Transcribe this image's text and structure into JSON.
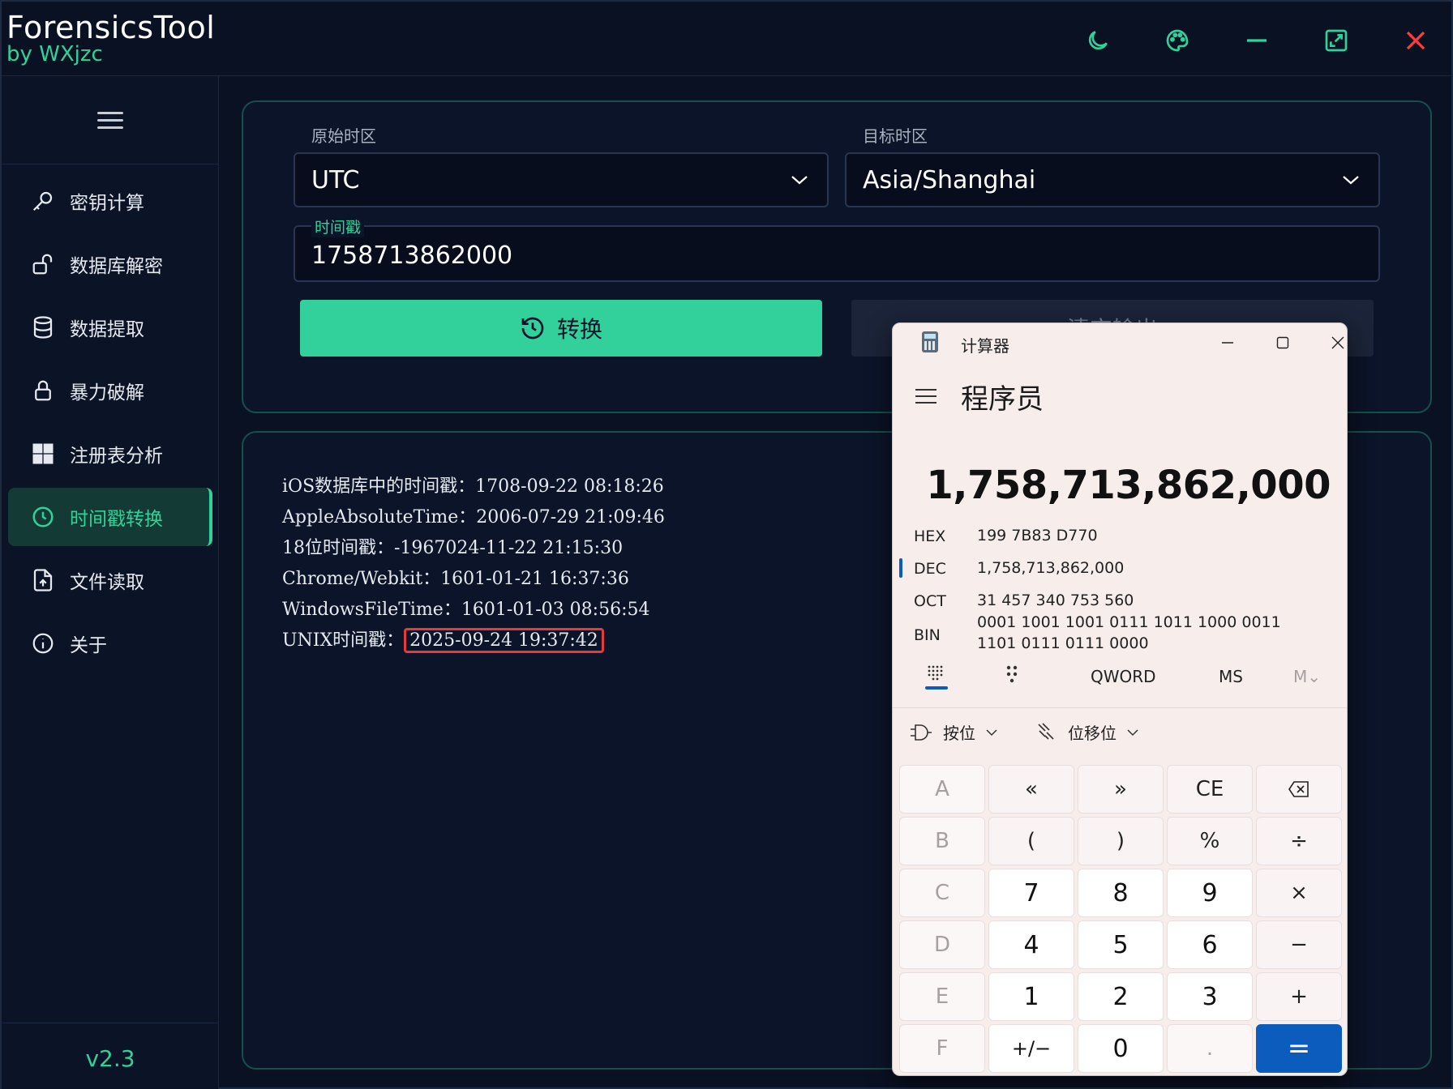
{
  "app": {
    "title": "ForensicsTool",
    "subtitle": "by WXjzc",
    "accent": "#2fd39a",
    "version": "v2.3"
  },
  "sidebar": {
    "items": [
      {
        "label": "密钥计算",
        "icon": "key-icon"
      },
      {
        "label": "数据库解密",
        "icon": "unlock-icon"
      },
      {
        "label": "数据提取",
        "icon": "database-icon"
      },
      {
        "label": "暴力破解",
        "icon": "lock-icon"
      },
      {
        "label": "注册表分析",
        "icon": "windows-icon"
      },
      {
        "label": "时间戳转换",
        "icon": "clock-icon",
        "active": true
      },
      {
        "label": "文件读取",
        "icon": "file-icon"
      },
      {
        "label": "关于",
        "icon": "info-icon"
      }
    ]
  },
  "form": {
    "source_tz_label": "原始时区",
    "source_tz_value": "UTC",
    "target_tz_label": "目标时区",
    "target_tz_value": "Asia/Shanghai",
    "timestamp_label": "时间戳",
    "timestamp_value": "1758713862000",
    "convert_label": "转换",
    "clear_label": "清空输出"
  },
  "results": [
    {
      "label": "iOS数据库中的时间戳：",
      "value": "1708-09-22 08:18:26"
    },
    {
      "label": "AppleAbsoluteTime：",
      "value": "2006-07-29 21:09:46"
    },
    {
      "label": "18位时间戳：",
      "value": "-1967024-11-22 21:15:30"
    },
    {
      "label": "Chrome/Webkit：",
      "value": "1601-01-21 16:37:36"
    },
    {
      "label": "WindowsFileTime：",
      "value": "1601-01-03 08:56:54"
    },
    {
      "label": "UNIX时间戳：",
      "value": "2025-09-24 19:37:42",
      "highlighted": true
    }
  ],
  "calculator": {
    "window_title": "计算器",
    "mode": "程序员",
    "display": "1,758,713,862,000",
    "radix": [
      {
        "name": "HEX",
        "value": "199 7B83 D770"
      },
      {
        "name": "DEC",
        "value": "1,758,713,862,000"
      },
      {
        "name": "OCT",
        "value": "31 457 340 753 560"
      },
      {
        "name": "BIN",
        "value": "0001 1001 1001 0111 1011 1000 0011 1101 0111 0111 0000"
      }
    ],
    "word_size": "QWORD",
    "ms": "MS",
    "mv": "M⌄",
    "bitwise_label": "按位",
    "bitshift_label": "位移位",
    "keys": [
      [
        "A",
        "«",
        "»",
        "CE",
        "⌫"
      ],
      [
        "B",
        "(",
        ")",
        "%",
        "÷"
      ],
      [
        "C",
        "7",
        "8",
        "9",
        "×"
      ],
      [
        "D",
        "4",
        "5",
        "6",
        "−"
      ],
      [
        "E",
        "1",
        "2",
        "3",
        "+"
      ],
      [
        "F",
        "+/−",
        "0",
        ".",
        "="
      ]
    ],
    "accent": "#0b5cbd"
  }
}
